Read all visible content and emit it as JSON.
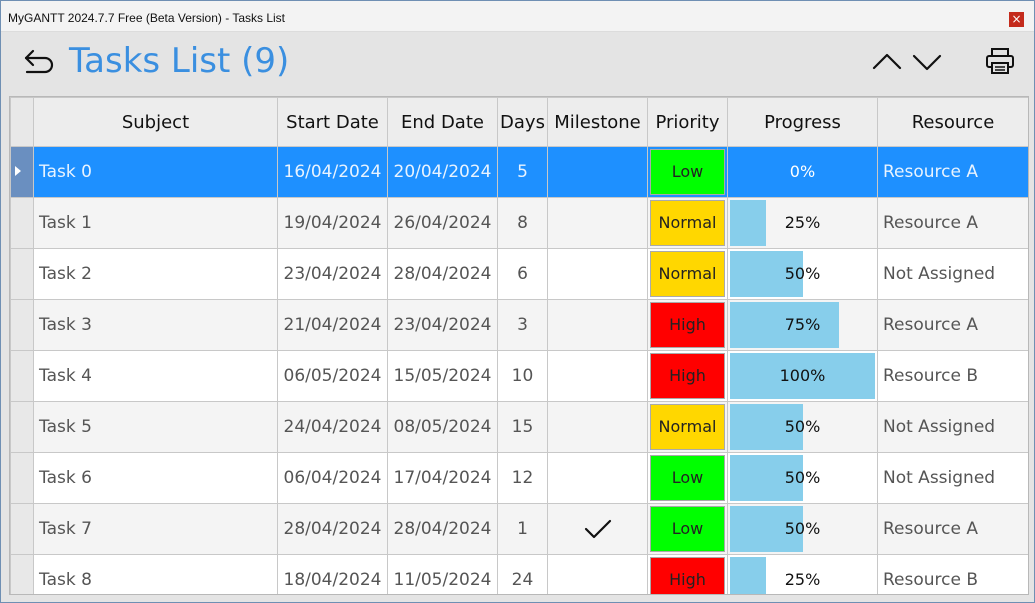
{
  "window": {
    "title": "MyGANTT 2024.7.7 Free (Beta Version) - Tasks List",
    "close_glyph": "×"
  },
  "header": {
    "title": "Tasks List (9)"
  },
  "colors": {
    "accent": "#3a8fe0",
    "selected_row": "#1e90ff",
    "priority_low": "#00ff00",
    "priority_normal": "#ffd700",
    "priority_high": "#ff0000",
    "progress_fill": "#87ceeb"
  },
  "icons": {
    "back": "back-arrow-icon",
    "up": "chevron-up-icon",
    "down": "chevron-down-icon",
    "print": "printer-icon",
    "milestone": "checkmark-icon"
  },
  "table": {
    "columns": [
      "Subject",
      "Start Date",
      "End Date",
      "Days",
      "Milestone",
      "Priority",
      "Progress",
      "Resource"
    ],
    "rows": [
      {
        "subject": "Task 0",
        "start": "16/04/2024",
        "end": "20/04/2024",
        "days": "5",
        "milestone": false,
        "priority": "Low",
        "progress": 0,
        "progress_label": "0%",
        "resource": "Resource A",
        "selected": true
      },
      {
        "subject": "Task 1",
        "start": "19/04/2024",
        "end": "26/04/2024",
        "days": "8",
        "milestone": false,
        "priority": "Normal",
        "progress": 25,
        "progress_label": "25%",
        "resource": "Resource A",
        "selected": false
      },
      {
        "subject": "Task 2",
        "start": "23/04/2024",
        "end": "28/04/2024",
        "days": "6",
        "milestone": false,
        "priority": "Normal",
        "progress": 50,
        "progress_label": "50%",
        "resource": "Not Assigned",
        "selected": false
      },
      {
        "subject": "Task 3",
        "start": "21/04/2024",
        "end": "23/04/2024",
        "days": "3",
        "milestone": false,
        "priority": "High",
        "progress": 75,
        "progress_label": "75%",
        "resource": "Resource A",
        "selected": false
      },
      {
        "subject": "Task 4",
        "start": "06/05/2024",
        "end": "15/05/2024",
        "days": "10",
        "milestone": false,
        "priority": "High",
        "progress": 100,
        "progress_label": "100%",
        "resource": "Resource B",
        "selected": false
      },
      {
        "subject": "Task 5",
        "start": "24/04/2024",
        "end": "08/05/2024",
        "days": "15",
        "milestone": false,
        "priority": "Normal",
        "progress": 50,
        "progress_label": "50%",
        "resource": "Not Assigned",
        "selected": false
      },
      {
        "subject": "Task 6",
        "start": "06/04/2024",
        "end": "17/04/2024",
        "days": "12",
        "milestone": false,
        "priority": "Low",
        "progress": 50,
        "progress_label": "50%",
        "resource": "Not Assigned",
        "selected": false
      },
      {
        "subject": "Task 7",
        "start": "28/04/2024",
        "end": "28/04/2024",
        "days": "1",
        "milestone": true,
        "priority": "Low",
        "progress": 50,
        "progress_label": "50%",
        "resource": "Resource A",
        "selected": false
      },
      {
        "subject": "Task 8",
        "start": "18/04/2024",
        "end": "11/05/2024",
        "days": "24",
        "milestone": false,
        "priority": "High",
        "progress": 25,
        "progress_label": "25%",
        "resource": "Resource B",
        "selected": false
      }
    ]
  }
}
